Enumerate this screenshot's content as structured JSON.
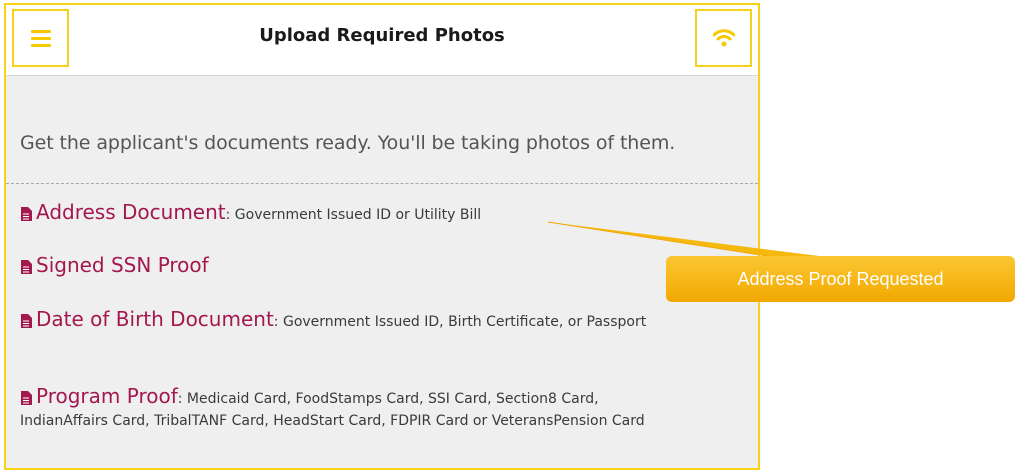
{
  "header": {
    "title": "Upload Required Photos",
    "menu_icon": "hamburger-menu-icon",
    "status_icon": "wifi-icon",
    "accent_color": "#f7d117"
  },
  "intro_text": "Get the applicant's documents ready. You'll be taking photos of them.",
  "documents": [
    {
      "name": "Address Document",
      "desc": ": Government Issued ID or Utility Bill",
      "icon": "document-icon"
    },
    {
      "name": "Signed SSN Proof",
      "desc": "",
      "icon": "document-icon"
    },
    {
      "name": "Date of Birth Document",
      "desc": ": Government Issued ID, Birth Certificate, or Passport",
      "icon": "document-icon"
    },
    {
      "name": "Program Proof",
      "desc": ": Medicaid Card, FoodStamps Card, SSI Card, Section8 Card, IndianAffairs Card, TribalTANF Card, HeadStart Card, FDPIR Card or VeteransPension Card",
      "icon": "document-icon"
    }
  ],
  "callout": {
    "label": "Address Proof Requested",
    "color": "#f4b400"
  }
}
